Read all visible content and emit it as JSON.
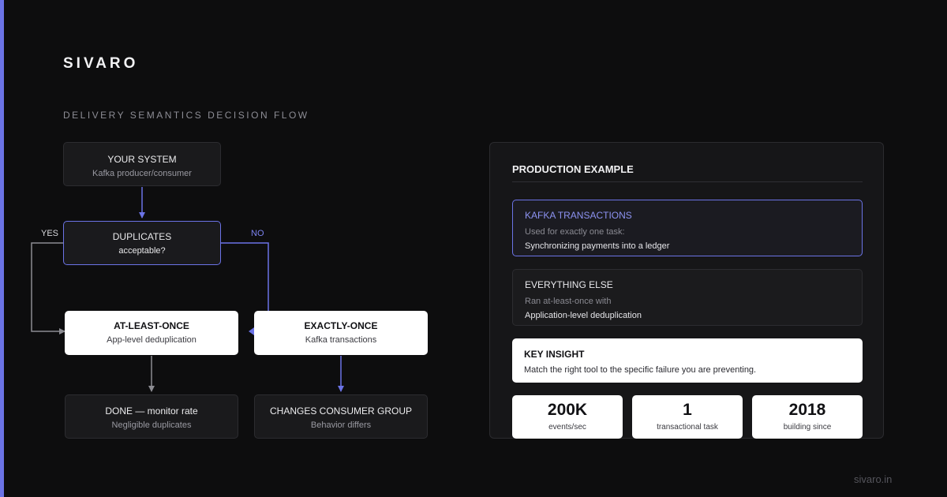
{
  "brand": "SIVARO",
  "section_title": "DELIVERY SEMANTICS DECISION FLOW",
  "flow": {
    "your_system": {
      "title": "YOUR SYSTEM",
      "subtitle": "Kafka producer/consumer"
    },
    "duplicates": {
      "title": "DUPLICATES",
      "subtitle": "acceptable?"
    },
    "yes_label": "YES",
    "no_label": "NO",
    "at_least_once": {
      "title": "AT-LEAST-ONCE",
      "subtitle": "App-level deduplication"
    },
    "exactly_once": {
      "title": "EXACTLY-ONCE",
      "subtitle": "Kafka transactions"
    },
    "done": {
      "title": "DONE — monitor rate",
      "subtitle": "Negligible duplicates"
    },
    "changes": {
      "title": "CHANGES CONSUMER GROUP",
      "subtitle": "Behavior differs"
    }
  },
  "panel": {
    "title": "PRODUCTION EXAMPLE",
    "kafka": {
      "heading": "KAFKA TRANSACTIONS",
      "sub": "Used for exactly one task:",
      "body": "Synchronizing payments into a ledger"
    },
    "everything_else": {
      "heading": "EVERYTHING ELSE",
      "sub": "Ran at-least-once with",
      "body": "Application-level deduplication"
    },
    "insight": {
      "heading": "KEY INSIGHT",
      "body": "Match the right tool to the specific failure you are preventing."
    },
    "stats": [
      {
        "value": "200K",
        "label": "events/sec"
      },
      {
        "value": "1",
        "label": "transactional task"
      },
      {
        "value": "2018",
        "label": "building since"
      }
    ]
  },
  "footer": "sivaro.in",
  "colors": {
    "accent": "#6b73e6",
    "background": "#0d0d0e",
    "card_light": "#ffffff",
    "connector_gray": "#8c8c92"
  }
}
